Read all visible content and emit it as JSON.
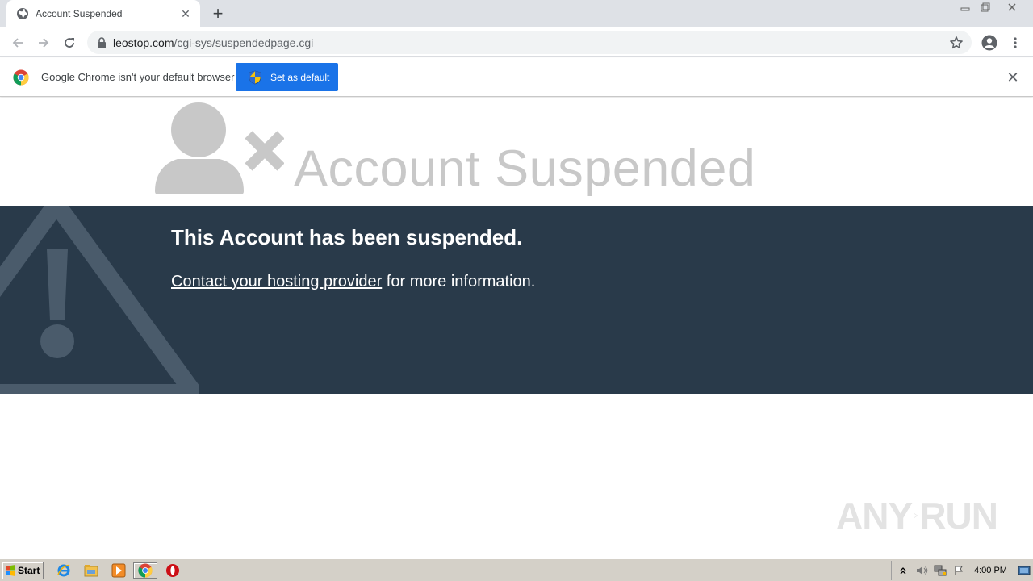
{
  "browser": {
    "tab_title": "Account Suspended",
    "tab_close": "✕",
    "new_tab": "+",
    "url_host": "leostop.com",
    "url_path": "/cgi-sys/suspendedpage.cgi"
  },
  "infobar": {
    "message": "Google Chrome isn't your default browser",
    "button_label": "Set as default",
    "close": "✕"
  },
  "page": {
    "headline": "Account Suspended",
    "heading": "This Account has been suspended.",
    "link_text": "Contact your hosting provider",
    "rest_text": " for more information."
  },
  "watermark": {
    "left": "ANY",
    "right": "RUN"
  },
  "taskbar": {
    "start_label": "Start",
    "clock": "4:00 PM",
    "icons": [
      "ie-icon",
      "explorer-icon",
      "media-player-icon",
      "chrome-icon",
      "opera-icon"
    ]
  },
  "colors": {
    "band": "#293a4a",
    "band_icon": "#4a5b6b",
    "headline": "#c8c8c8",
    "primary_button": "#1a73e8"
  }
}
